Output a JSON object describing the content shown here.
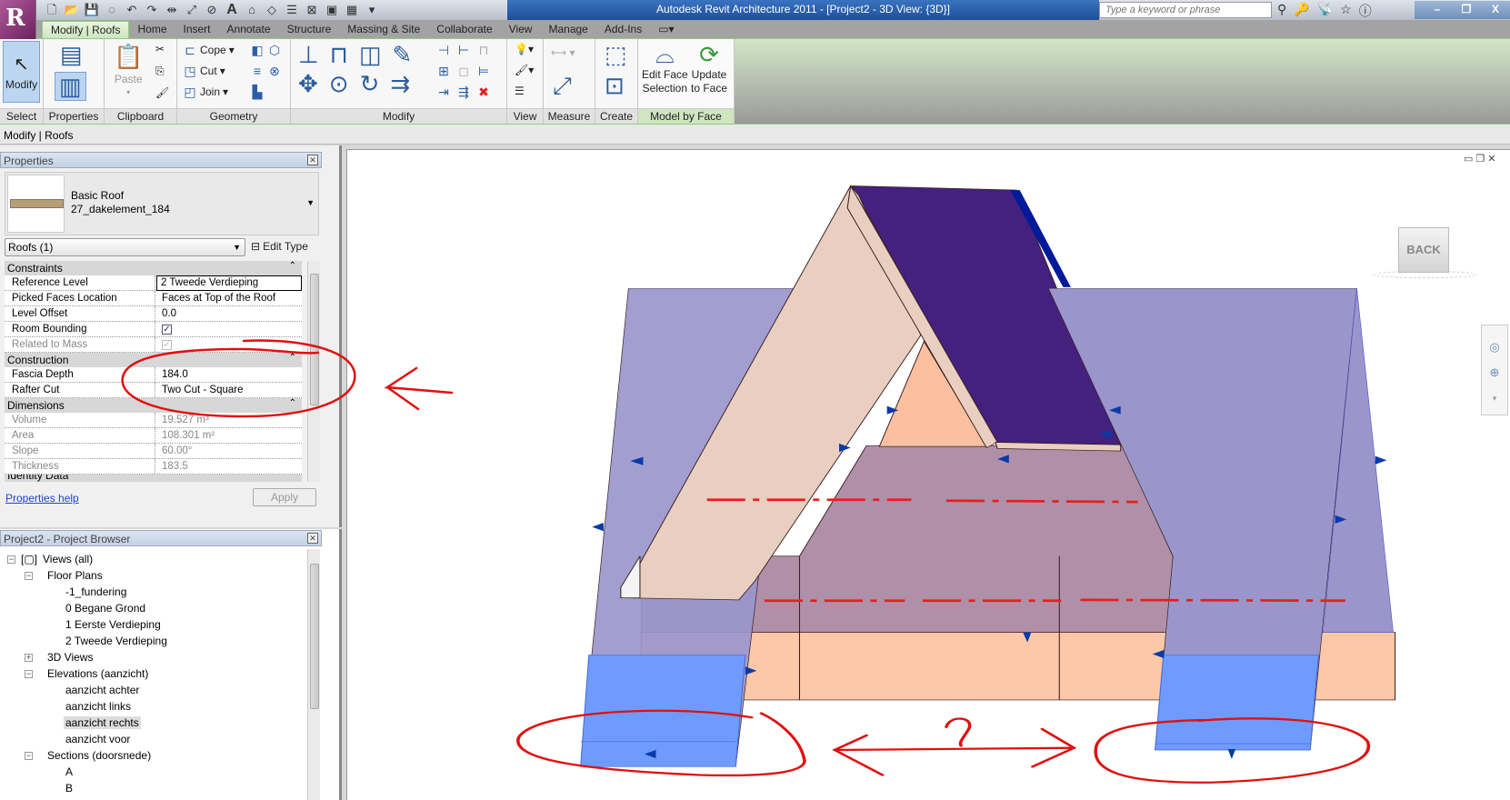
{
  "window": {
    "title": "Autodesk Revit Architecture 2011 - [Project2 - 3D View: {3D}]",
    "search_placeholder": "Type a keyword or phrase",
    "logo_letter": "R"
  },
  "tabs": [
    "Modify | Roofs",
    "Home",
    "Insert",
    "Annotate",
    "Structure",
    "Massing & Site",
    "Collaborate",
    "View",
    "Manage",
    "Add-Ins"
  ],
  "ribbon": {
    "panels": [
      "Select",
      "Properties",
      "Clipboard",
      "Geometry",
      "Modify",
      "View",
      "Measure",
      "Create",
      "Model by Face"
    ],
    "modify_label": "Modify",
    "paste_label": "Paste",
    "cope_label": "Cope",
    "cut_label": "Cut",
    "join_label": "Join",
    "edit_face_label": "Edit Face",
    "edit_face_label2": "Selection",
    "update_label": "Update",
    "update_label2": "to Face"
  },
  "context_bar": "Modify | Roofs",
  "properties": {
    "title": "Properties",
    "type_family": "Basic Roof",
    "type_name": "27_dakelement_184",
    "selector": "Roofs (1)",
    "edit_type": "Edit Type",
    "groups": [
      {
        "name": "Constraints",
        "rows": [
          {
            "key": "Reference Level",
            "value": "2 Tweede Verdieping"
          },
          {
            "key": "Picked Faces Location",
            "value": "Faces at Top of the Roof"
          },
          {
            "key": "Level Offset",
            "value": "0.0"
          },
          {
            "key": "Room Bounding",
            "value": "checked"
          },
          {
            "key": "Related to Mass",
            "value": "checked-disabled"
          }
        ]
      },
      {
        "name": "Construction",
        "rows": [
          {
            "key": "Fascia Depth",
            "value": "184.0"
          },
          {
            "key": "Rafter Cut",
            "value": "Two Cut - Square"
          }
        ]
      },
      {
        "name": "Dimensions",
        "rows": [
          {
            "key": "Volume",
            "value": "19.527 m³"
          },
          {
            "key": "Area",
            "value": "108.301 m²"
          },
          {
            "key": "Slope",
            "value": "60.00°"
          },
          {
            "key": "Thickness",
            "value": "183.5"
          }
        ]
      },
      {
        "name": "Identity Data",
        "rows": []
      }
    ],
    "help_link": "Properties help",
    "apply": "Apply"
  },
  "browser": {
    "title": "Project2 - Project Browser",
    "items": [
      {
        "label": "Views (all)",
        "level": 0,
        "exp": "-"
      },
      {
        "label": "Floor Plans",
        "level": 1,
        "exp": "-"
      },
      {
        "label": "-1_fundering",
        "level": 2
      },
      {
        "label": "0 Begane Grond",
        "level": 2
      },
      {
        "label": "1 Eerste Verdieping",
        "level": 2
      },
      {
        "label": "2 Tweede Verdieping",
        "level": 2
      },
      {
        "label": "3D Views",
        "level": 1,
        "exp": "+"
      },
      {
        "label": "Elevations (aanzicht)",
        "level": 1,
        "exp": "-"
      },
      {
        "label": "aanzicht achter",
        "level": 2
      },
      {
        "label": "aanzicht links",
        "level": 2
      },
      {
        "label": "aanzicht rechts",
        "level": 2,
        "selected": true
      },
      {
        "label": "aanzicht voor",
        "level": 2
      },
      {
        "label": "Sections (doorsnede)",
        "level": 1,
        "exp": "-"
      },
      {
        "label": "A",
        "level": 2
      },
      {
        "label": "B",
        "level": 2
      }
    ]
  },
  "viewport": {
    "viewcube_face": "BACK",
    "annotation_question": "?",
    "colors": {
      "roof_dark": "#44207f",
      "roof_slab": "#9a96cc",
      "roof_bottom": "#6f9bff",
      "fascia": "#e8cfc0",
      "wall": "#fcc8a8",
      "annotation": "#e01010"
    }
  }
}
